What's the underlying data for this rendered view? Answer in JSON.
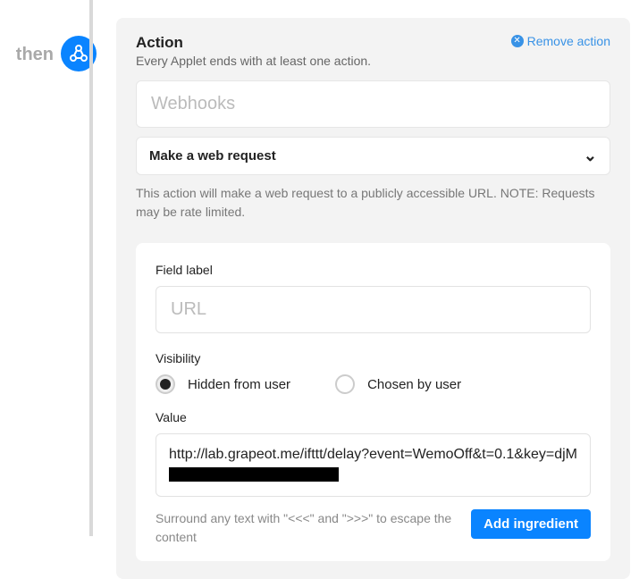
{
  "sidebar": {
    "then_label": "then"
  },
  "action": {
    "title": "Action",
    "remove_label": "Remove action",
    "subtitle": "Every Applet ends with at least one action.",
    "service_placeholder": "Webhooks",
    "action_type_selected": "Make a web request",
    "action_description": "This action will make a web request to a publicly accessible URL. NOTE: Requests may be rate limited."
  },
  "form": {
    "field_label_caption": "Field label",
    "url_placeholder": "URL",
    "visibility_caption": "Visibility",
    "visibility_options": {
      "hidden": "Hidden from user",
      "chosen": "Chosen by user"
    },
    "value_caption": "Value",
    "value_text_prefix": "http://lab.grapeot.me/ifttt/delay?event=WemoOff&t=0.1&key=djM",
    "escape_hint": "Surround any text with \"<<<\" and \">>>\" to escape the content",
    "add_ingredient_label": "Add ingredient"
  }
}
